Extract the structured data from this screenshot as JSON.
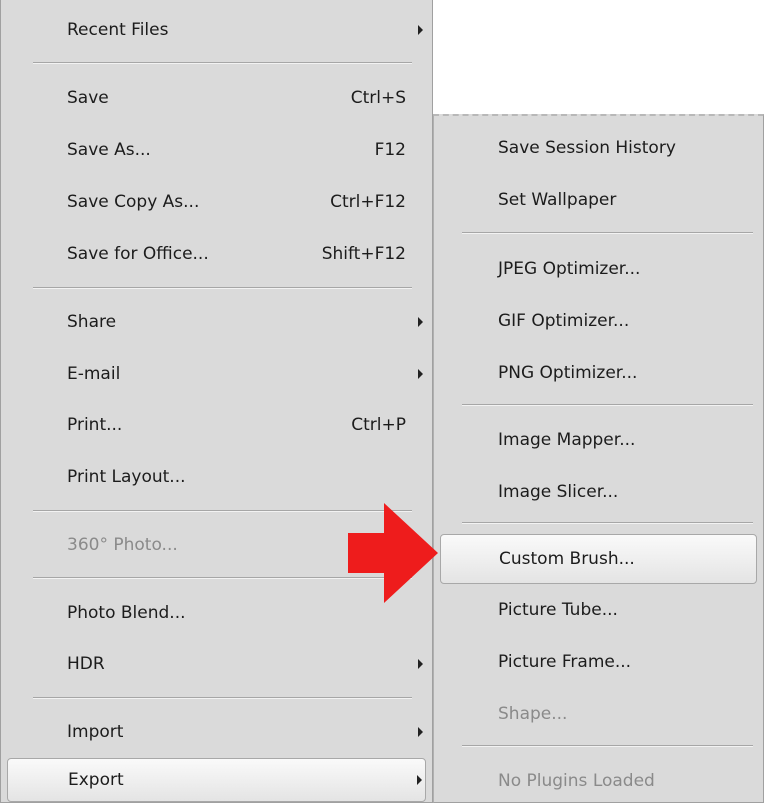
{
  "main_menu": {
    "recent_files": "Recent Files",
    "save": "Save",
    "save_shortcut": "Ctrl+S",
    "save_as": "Save As...",
    "save_as_shortcut": "F12",
    "save_copy_as": "Save Copy As...",
    "save_copy_as_shortcut": "Ctrl+F12",
    "save_for_office": "Save for Office...",
    "save_for_office_shortcut": "Shift+F12",
    "share": "Share",
    "email": "E-mail",
    "print": "Print...",
    "print_shortcut": "Ctrl+P",
    "print_layout": "Print Layout...",
    "photo_360": "360° Photo...",
    "photo_blend": "Photo Blend...",
    "hdr": "HDR",
    "import": "Import",
    "export": "Export"
  },
  "sub_menu": {
    "save_session_history": "Save Session History",
    "set_wallpaper": "Set Wallpaper",
    "jpeg_optimizer": "JPEG Optimizer...",
    "gif_optimizer": "GIF Optimizer...",
    "png_optimizer": "PNG Optimizer...",
    "image_mapper": "Image Mapper...",
    "image_slicer": "Image Slicer...",
    "custom_brush": "Custom Brush...",
    "picture_tube": "Picture Tube...",
    "picture_frame": "Picture Frame...",
    "shape": "Shape...",
    "no_plugins": "No Plugins Loaded"
  },
  "colors": {
    "menu_bg": "#dadada",
    "pointer_arrow": "#ee1c1c",
    "disabled_text": "#8a8a8a"
  },
  "icons": {
    "submenu": "submenu-arrow-icon",
    "pointer": "red-pointer-arrow"
  }
}
